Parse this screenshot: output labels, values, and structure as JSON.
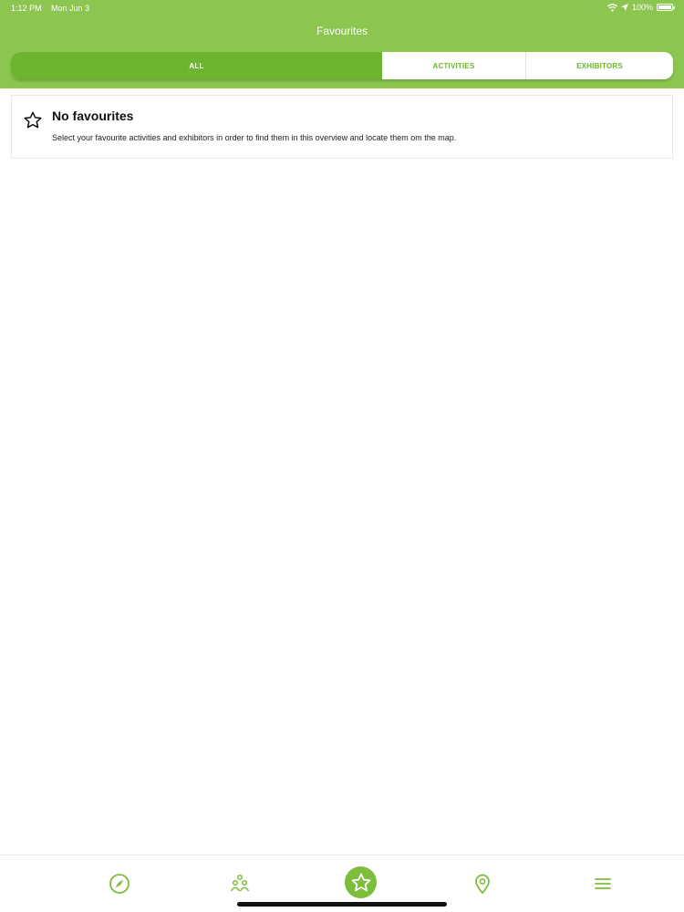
{
  "status_bar": {
    "time": "1:12 PM",
    "date": "Mon Jun 3",
    "battery": "100%"
  },
  "header": {
    "title": "Favourites"
  },
  "tabs": [
    {
      "label": "ALL",
      "selected": true
    },
    {
      "label": "ACTIVITIES",
      "selected": false
    },
    {
      "label": "EXHIBITORS",
      "selected": false
    }
  ],
  "empty_state": {
    "icon": "star-outline-icon",
    "title": "No favourites",
    "description": "Select your favourite activities and exhibitors in order to find them in this overview and locate them om the map."
  },
  "bottom_nav": [
    {
      "icon": "compass-icon",
      "selected": false
    },
    {
      "icon": "people-icon",
      "selected": false
    },
    {
      "icon": "star-icon",
      "selected": true
    },
    {
      "icon": "map-pin-icon",
      "selected": false
    },
    {
      "icon": "menu-icon",
      "selected": false
    }
  ],
  "colors": {
    "brand_green": "#8cc54f",
    "accent_green": "#6db52e"
  }
}
